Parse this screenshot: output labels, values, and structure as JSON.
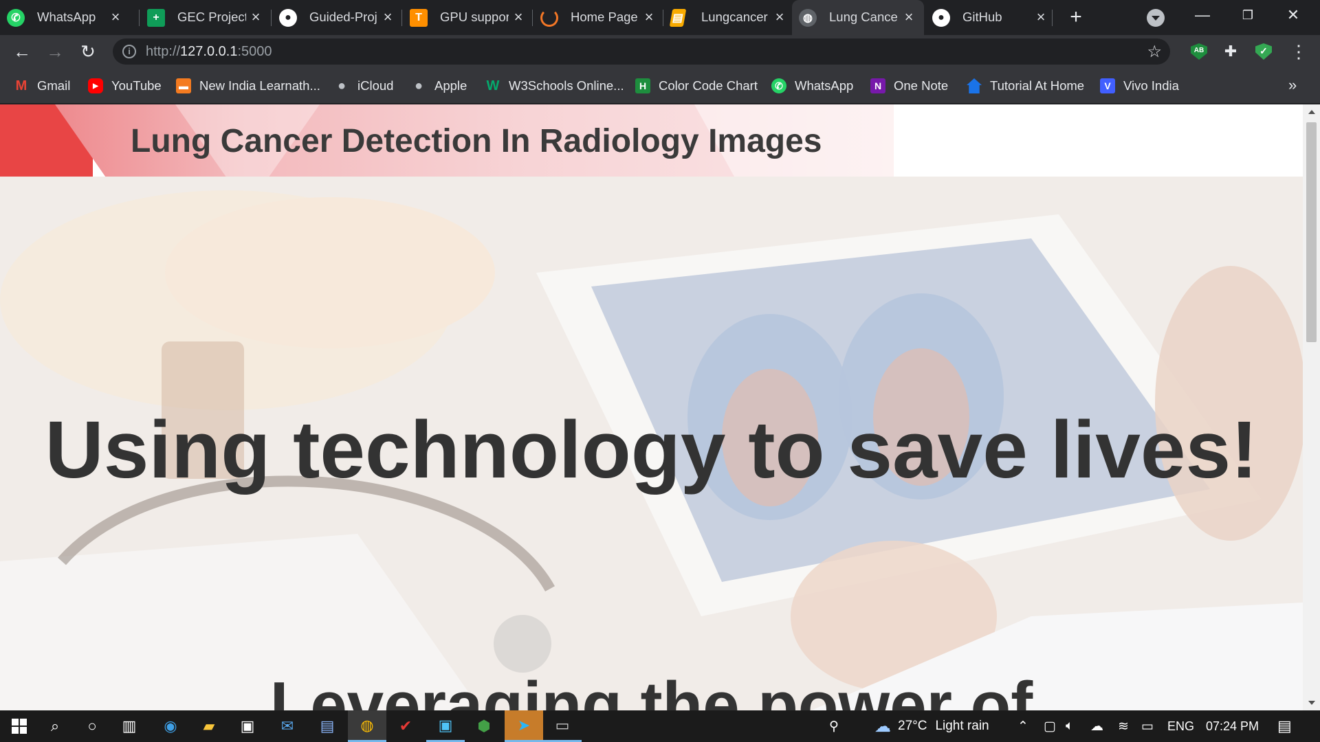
{
  "browser": {
    "tabs": [
      {
        "label": "WhatsApp",
        "icon": "whatsapp-icon",
        "color": "#25d366"
      },
      {
        "label": "GEC Project",
        "icon": "sheets-icon",
        "color": "#0f9d58"
      },
      {
        "label": "Guided-Proj",
        "icon": "github-icon",
        "color": "#ffffff"
      },
      {
        "label": "GPU support",
        "icon": "tensorflow-icon",
        "color": "#ff8f00"
      },
      {
        "label": "Home Page",
        "icon": "jupyter-icon",
        "color": "#f37726"
      },
      {
        "label": "Lungcancer",
        "icon": "notebook-icon",
        "color": "#f9ab00"
      },
      {
        "label": "Lung Cance",
        "icon": "globe-icon",
        "color": "#9aa0a6"
      },
      {
        "label": "GitHub",
        "icon": "github-icon",
        "color": "#ffffff"
      }
    ],
    "active_tab_index": 6,
    "url_scheme": "http://",
    "url_host": "127.0.0.1",
    "url_port": ":5000",
    "bookmarks": [
      {
        "label": "Gmail",
        "icon": "gmail-icon",
        "color": "#ea4335"
      },
      {
        "label": "YouTube",
        "icon": "youtube-icon",
        "color": "#ff0000"
      },
      {
        "label": "New India Learnath...",
        "icon": "learnathon-icon",
        "color": "#f47b20"
      },
      {
        "label": "iCloud",
        "icon": "apple-icon",
        "color": "#bdc1c6"
      },
      {
        "label": "Apple",
        "icon": "apple-icon",
        "color": "#bdc1c6"
      },
      {
        "label": "W3Schools Online...",
        "icon": "w3schools-icon",
        "color": "#04aa6d"
      },
      {
        "label": "Color Code Chart",
        "icon": "h-icon",
        "color": "#1e8e3e"
      },
      {
        "label": "WhatsApp",
        "icon": "whatsapp-icon",
        "color": "#25d366"
      },
      {
        "label": "One Note",
        "icon": "onenote-icon",
        "color": "#7719aa"
      },
      {
        "label": "Tutorial At Home",
        "icon": "house-icon",
        "color": "#1a73e8"
      },
      {
        "label": "Vivo India",
        "icon": "vivo-icon",
        "color": "#415fff"
      }
    ]
  },
  "page": {
    "title": "Lung Cancer Detection In Radiology Images",
    "hero_heading": "Using technology to save lives!",
    "hero_subheading": "Leveraging the power of"
  },
  "taskbar": {
    "weather_temp": "27°C",
    "weather_text": "Light rain",
    "language": "ENG",
    "time": "07:24 PM"
  },
  "colors": {
    "header_red": "#e84545",
    "header_pink": "#f7d3d5",
    "heading_text": "#333333",
    "chrome_dark": "#202124",
    "chrome_toolbar": "#35363a"
  }
}
